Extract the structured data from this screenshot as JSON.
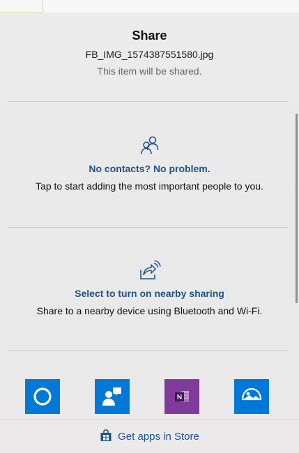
{
  "share": {
    "title": "Share",
    "filename": "FB_IMG_1574387551580.jpg",
    "subtitle": "This item will be shared."
  },
  "contacts": {
    "icon": "people-icon",
    "link": "No contacts? No problem.",
    "description": "Tap to start adding the most important people to you."
  },
  "nearby": {
    "icon": "nearby-share-icon",
    "link": "Select to turn on nearby sharing",
    "description": "Share to a nearby device using Bluetooth and Wi-Fi."
  },
  "apps": [
    {
      "name": "Cortana",
      "icon": "cortana-icon",
      "color": "#0078d7"
    },
    {
      "name": "People",
      "icon": "people-app-icon",
      "color": "#0078d7"
    },
    {
      "name": "OneNote",
      "icon": "onenote-icon",
      "color": "#7f3a9a"
    },
    {
      "name": "Photos",
      "icon": "photos-icon",
      "color": "#0078d7"
    }
  ],
  "store": {
    "icon": "store-bag-icon",
    "label": "Get apps in Store"
  },
  "colors": {
    "accent": "#1d5489",
    "tile_blue": "#0078d7",
    "onenote_purple": "#7f3a9a",
    "background": "#ebebeb"
  }
}
